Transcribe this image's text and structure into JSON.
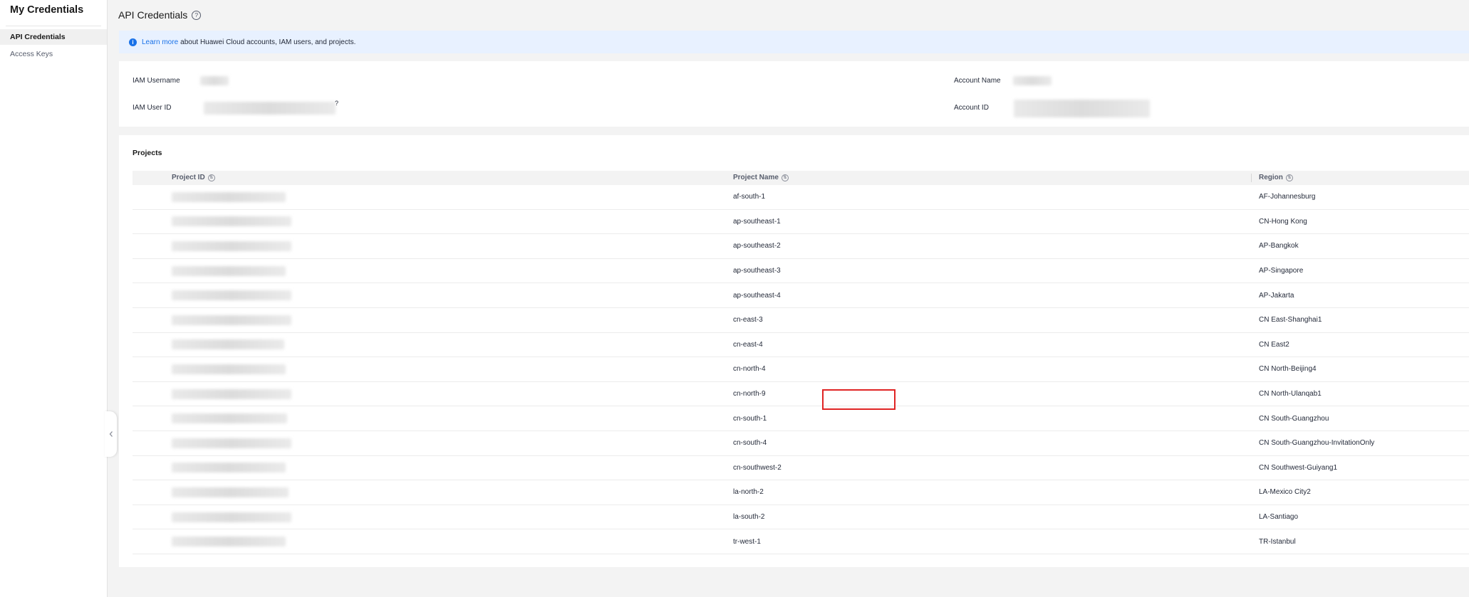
{
  "sidebar": {
    "title": "My Credentials",
    "items": [
      {
        "label": "API Credentials",
        "active": true
      },
      {
        "label": "Access Keys",
        "active": false
      }
    ],
    "collapse_icon": "chevron-left-icon"
  },
  "header": {
    "title": "API Credentials",
    "help_icon": "?"
  },
  "banner": {
    "icon": "i",
    "link_text": "Learn more",
    "text": "about Huawei Cloud accounts, IAM users, and projects."
  },
  "account_info": {
    "iam_username_label": "IAM Username",
    "iam_user_id_label": "IAM User ID",
    "account_name_label": "Account Name",
    "account_id_label": "Account ID",
    "iam_user_id_suffix": "?"
  },
  "projects": {
    "title": "Projects",
    "columns": {
      "project_id": "Project ID",
      "project_name": "Project Name",
      "region": "Region"
    },
    "rows": [
      {
        "name": "af-south-1",
        "region": "AF-Johannesburg"
      },
      {
        "name": "ap-southeast-1",
        "region": "CN-Hong Kong"
      },
      {
        "name": "ap-southeast-2",
        "region": "AP-Bangkok"
      },
      {
        "name": "ap-southeast-3",
        "region": "AP-Singapore"
      },
      {
        "name": "ap-southeast-4",
        "region": "AP-Jakarta"
      },
      {
        "name": "cn-east-3",
        "region": "CN East-Shanghai1"
      },
      {
        "name": "cn-east-4",
        "region": "CN East2"
      },
      {
        "name": "cn-north-4",
        "region": "CN North-Beijing4"
      },
      {
        "name": "cn-north-9",
        "region": "CN North-Ulanqab1"
      },
      {
        "name": "cn-south-1",
        "region": "CN South-Guangzhou"
      },
      {
        "name": "cn-south-4",
        "region": "CN South-Guangzhou-InvitationOnly"
      },
      {
        "name": "cn-southwest-2",
        "region": "CN Southwest-Guiyang1"
      },
      {
        "name": "la-north-2",
        "region": "LA-Mexico City2"
      },
      {
        "name": "la-south-2",
        "region": "LA-Santiago"
      },
      {
        "name": "tr-west-1",
        "region": "TR-Istanbul"
      }
    ]
  },
  "colors": {
    "accent": "#1a72e8",
    "banner_bg": "#e8f1ff",
    "highlight": "#e02424"
  }
}
